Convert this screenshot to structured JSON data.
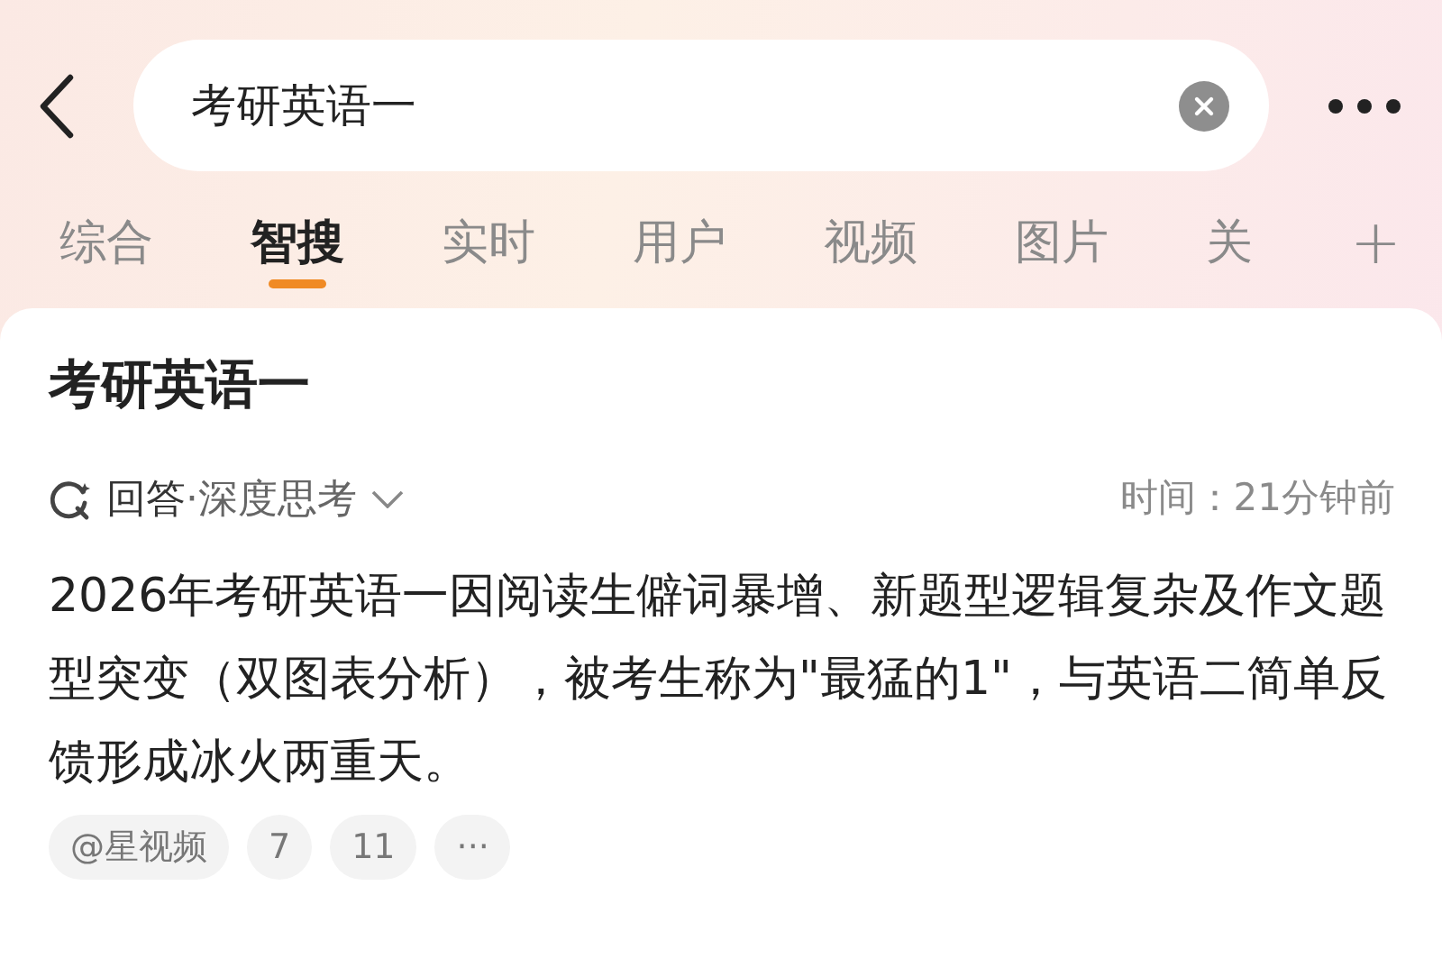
{
  "search": {
    "value": "考研英语一"
  },
  "tabs": [
    {
      "label": "综合",
      "selected": false
    },
    {
      "label": "智搜",
      "selected": true
    },
    {
      "label": "实时",
      "selected": false
    },
    {
      "label": "用户",
      "selected": false
    },
    {
      "label": "视频",
      "selected": false
    },
    {
      "label": "图片",
      "selected": false
    },
    {
      "label": "关",
      "selected": false
    }
  ],
  "tab_add": "+",
  "card": {
    "title": "考研英语一",
    "mode": "回答",
    "mode_detail": "·深度思考",
    "time": "时间：21分钟前",
    "answer": "2026年考研英语一因阅读生僻词暴增、新题型逻辑复杂及作文题型突变（双图表分析），被考生称为\"最猛的1\"，与英语二简单反馈形成冰火两重天。",
    "sources": [
      {
        "label": "@星视频"
      },
      {
        "label": "7"
      },
      {
        "label": "11"
      },
      {
        "label": "···"
      }
    ]
  }
}
